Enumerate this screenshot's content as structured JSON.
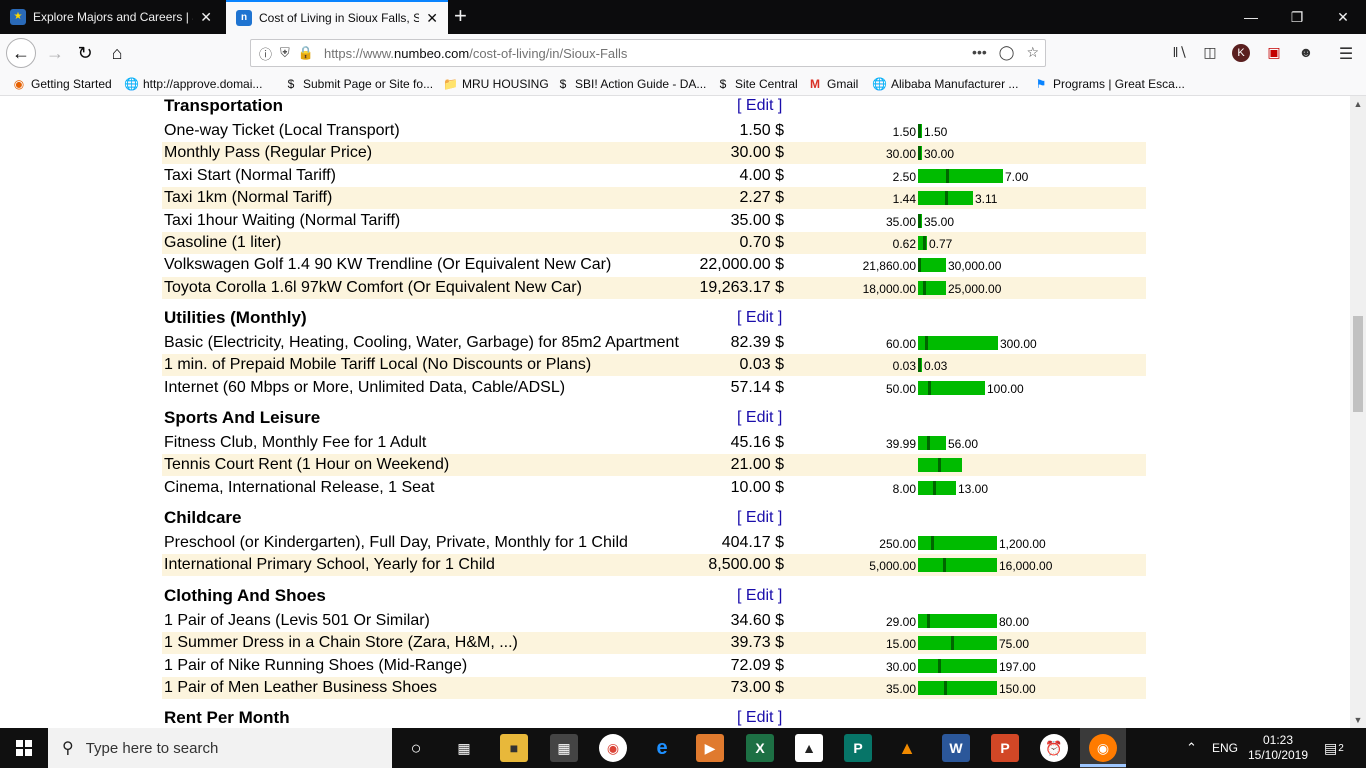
{
  "browser": {
    "tabs": [
      {
        "title": "Explore Majors and Careers | So",
        "icon": "graduation-icon"
      },
      {
        "title": "Cost of Living in Sioux Falls, So",
        "icon": "numbeo-icon",
        "active": true
      }
    ],
    "url_prefix": "https://www.",
    "url_host": "numbeo.com",
    "url_path": "/cost-of-living/in/Sioux-Falls",
    "bookmarks": [
      {
        "label": "Getting Started",
        "icon": "firefox-icon"
      },
      {
        "label": "http://approve.domai...",
        "icon": "globe-icon"
      },
      {
        "label": "Submit Page or Site fo...",
        "icon": "dollar-icon"
      },
      {
        "label": "MRU HOUSING",
        "icon": "folder-icon"
      },
      {
        "label": "SBI! Action Guide - DA...",
        "icon": "dollar-icon"
      },
      {
        "label": "Site Central",
        "icon": "dollar-icon"
      },
      {
        "label": "Gmail",
        "icon": "gmail-icon"
      },
      {
        "label": "Alibaba Manufacturer ...",
        "icon": "globe-icon"
      },
      {
        "label": "Programs | Great Esca...",
        "icon": "bookmark-icon"
      }
    ],
    "url_overflow": "•••",
    "profile_letter": "K"
  },
  "page": {
    "edit_label": "[ Edit ]",
    "sections": [
      {
        "title": "Transportation",
        "rows": [
          {
            "name": "One-way Ticket (Local Transport)",
            "price": "1.50 $",
            "min": "1.50",
            "max": "1.50",
            "range_min": 1.5,
            "range_max": 1.5,
            "value": 1.5
          },
          {
            "name": "Monthly Pass (Regular Price)",
            "price": "30.00 $",
            "min": "30.00",
            "max": "30.00",
            "range_min": 30.0,
            "range_max": 30.0,
            "value": 30.0
          },
          {
            "name": "Taxi Start (Normal Tariff)",
            "price": "4.00 $",
            "min": "2.50",
            "max": "7.00",
            "range_min": 2.5,
            "range_max": 7.0,
            "value": 4.0
          },
          {
            "name": "Taxi 1km (Normal Tariff)",
            "price": "2.27 $",
            "min": "1.44",
            "max": "3.11",
            "range_min": 1.44,
            "range_max": 3.11,
            "value": 2.27
          },
          {
            "name": "Taxi 1hour Waiting (Normal Tariff)",
            "price": "35.00 $",
            "min": "35.00",
            "max": "35.00",
            "range_min": 35.0,
            "range_max": 35.0,
            "value": 35.0
          },
          {
            "name": "Gasoline (1 liter)",
            "price": "0.70 $",
            "min": "0.62",
            "max": "0.77",
            "range_min": 0.62,
            "range_max": 0.77,
            "value": 0.7
          },
          {
            "name": "Volkswagen Golf 1.4 90 KW Trendline (Or Equivalent New Car)",
            "price": "22,000.00 $",
            "min": "21,860.00",
            "max": "30,000.00",
            "range_min": 21860,
            "range_max": 30000,
            "value": 22000
          },
          {
            "name": "Toyota Corolla 1.6l 97kW Comfort (Or Equivalent New Car)",
            "price": "19,263.17 $",
            "min": "18,000.00",
            "max": "25,000.00",
            "range_min": 18000,
            "range_max": 25000,
            "value": 19263.17
          }
        ]
      },
      {
        "title": "Utilities (Monthly)",
        "rows": [
          {
            "name": "Basic (Electricity, Heating, Cooling, Water, Garbage) for 85m2 Apartment",
            "price": "82.39 $",
            "min": "60.00",
            "max": "300.00",
            "range_min": 60,
            "range_max": 300,
            "value": 82.39
          },
          {
            "name": "1 min. of Prepaid Mobile Tariff Local (No Discounts or Plans)",
            "price": "0.03 $",
            "min": "0.03",
            "max": "0.03",
            "range_min": 0.03,
            "range_max": 0.03,
            "value": 0.03
          },
          {
            "name": "Internet (60 Mbps or More, Unlimited Data, Cable/ADSL)",
            "price": "57.14 $",
            "min": "50.00",
            "max": "100.00",
            "range_min": 50,
            "range_max": 100,
            "value": 57.14
          }
        ]
      },
      {
        "title": "Sports And Leisure",
        "rows": [
          {
            "name": "Fitness Club, Monthly Fee for 1 Adult",
            "price": "45.16 $",
            "min": "39.99",
            "max": "56.00",
            "range_min": 39.99,
            "range_max": 56,
            "value": 45.16
          },
          {
            "name": "Tennis Court Rent (1 Hour on Weekend)",
            "price": "21.00 $",
            "min": "",
            "max": "",
            "range_min": 0,
            "range_max": 0,
            "value": 21
          },
          {
            "name": "Cinema, International Release, 1 Seat",
            "price": "10.00 $",
            "min": "8.00",
            "max": "13.00",
            "range_min": 8,
            "range_max": 13,
            "value": 10
          }
        ]
      },
      {
        "title": "Childcare",
        "rows": [
          {
            "name": "Preschool (or Kindergarten), Full Day, Private, Monthly for 1 Child",
            "price": "404.17 $",
            "min": "250.00",
            "max": "1,200.00",
            "range_min": 250,
            "range_max": 1200,
            "value": 404.17
          },
          {
            "name": "International Primary School, Yearly for 1 Child",
            "price": "8,500.00 $",
            "min": "5,000.00",
            "max": "16,000.00",
            "range_min": 5000,
            "range_max": 16000,
            "value": 8500
          }
        ]
      },
      {
        "title": "Clothing And Shoes",
        "rows": [
          {
            "name": "1 Pair of Jeans (Levis 501 Or Similar)",
            "price": "34.60 $",
            "min": "29.00",
            "max": "80.00",
            "range_min": 29,
            "range_max": 80,
            "value": 34.6
          },
          {
            "name": "1 Summer Dress in a Chain Store (Zara, H&M, ...)",
            "price": "39.73 $",
            "min": "15.00",
            "max": "75.00",
            "range_min": 15,
            "range_max": 75,
            "value": 39.73
          },
          {
            "name": "1 Pair of Nike Running Shoes (Mid-Range)",
            "price": "72.09 $",
            "min": "30.00",
            "max": "197.00",
            "range_min": 30,
            "range_max": 197,
            "value": 72.09
          },
          {
            "name": "1 Pair of Men Leather Business Shoes",
            "price": "73.00 $",
            "min": "35.00",
            "max": "150.00",
            "range_min": 35,
            "range_max": 150,
            "value": 73
          }
        ]
      },
      {
        "title": "Rent Per Month",
        "rows": []
      }
    ]
  },
  "taskbar": {
    "search_placeholder": "Type here to search",
    "language": "ENG",
    "time": "01:23",
    "date": "15/10/2019",
    "notification_count": "2"
  }
}
